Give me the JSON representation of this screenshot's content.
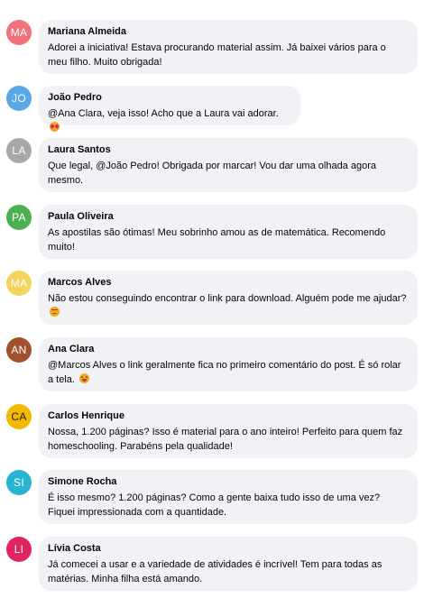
{
  "comments": [
    {
      "initials": "MA",
      "avatar_color": "#f0727a",
      "author": "Mariana Almeida",
      "text": "Adorei a iniciativa! Estava procurando material assim. Já baixei vários para o meu filho. Muito obrigada!",
      "emoji": ""
    },
    {
      "initials": "JO",
      "avatar_color": "#5aa9e6",
      "author": "João Pedro",
      "text": "@Ana Clara, veja isso! Acho que a Laura vai adorar.",
      "emoji": "smiling-face-with-heart-eyes"
    },
    {
      "initials": "LA",
      "avatar_color": "#a8a8a8",
      "author": "Laura Santos",
      "text": "Que legal, @João Pedro! Obrigada por marcar! Vou dar uma olhada agora mesmo.",
      "emoji": ""
    },
    {
      "initials": "PA",
      "avatar_color": "#4caf50",
      "author": "Paula Oliveira",
      "text": "As apostilas são ótimas! Meu sobrinho amou as de matemática. Recomendo muito!",
      "emoji": ""
    },
    {
      "initials": "MA",
      "avatar_color": "#f4d35e",
      "author": "Marcos Alves",
      "text": "Não estou conseguindo encontrar o link para download. Alguém pode me ajudar?",
      "emoji": "disappointed-face"
    },
    {
      "initials": "AN",
      "avatar_color": "#a0522d",
      "author": "Ana Clara",
      "text": "@Marcos Alves o link geralmente fica no primeiro comentário do post. É só rolar a tela.",
      "emoji": "winking-face-with-tongue"
    },
    {
      "initials": "CA",
      "avatar_color": "#f5b800",
      "author": "Carlos Henrique",
      "text": "Nossa, 1.200 páginas? Isso é material para o ano inteiro! Perfeito para quem faz homeschooling. Parabéns pela qualidade!",
      "emoji": ""
    },
    {
      "initials": "SI",
      "avatar_color": "#26b5cf",
      "author": "Simone Rocha",
      "text": "É isso mesmo? 1.200 páginas? Como a gente baixa tudo isso de uma vez? Fiquei impressionada com a quantidade.",
      "emoji": ""
    },
    {
      "initials": "LI",
      "avatar_color": "#e0245e",
      "author": "Lívia Costa",
      "text": "Já comecei a usar e a variedade de atividades é incrível! Tem para todas as matérias. Minha filha está amando.",
      "emoji": ""
    }
  ]
}
